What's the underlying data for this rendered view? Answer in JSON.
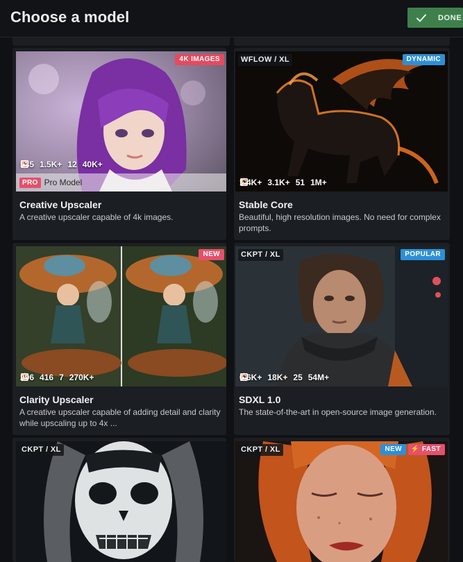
{
  "header": {
    "title": "Choose a model",
    "done_label": "DONE"
  },
  "cards": [
    {
      "name": "Creative Upscaler",
      "description": "A creative upscaler capable of 4k images.",
      "badges": [
        "4K IMAGES"
      ],
      "stats": {
        "stars": "535",
        "likes": "1.5K+",
        "comments": "12",
        "images": "40K+"
      },
      "pro_badge": "PRO",
      "pro_label": "Pro Model"
    },
    {
      "name": "Stable Core",
      "description": "Beautiful, high resolution images. No need for complex prompts.",
      "base": "WFLOW / XL",
      "badges": [
        "DYNAMIC"
      ],
      "stats": {
        "stars": "1.4K+",
        "likes": "3.1K+",
        "comments": "51",
        "images": "1M+"
      }
    },
    {
      "name": "Clarity Upscaler",
      "description": "A creative upscaler capable of adding detail and clarity while upscaling up to 4x ...",
      "badges": [
        "NEW"
      ],
      "stats": {
        "stars": "296",
        "likes": "416",
        "comments": "7",
        "images": "270K+"
      }
    },
    {
      "name": "SDXL 1.0",
      "description": "The state-of-the-art in open-source image generation.",
      "base": "CKPT / XL",
      "badges": [
        "POPULAR"
      ],
      "stats": {
        "stars": "6.6K+",
        "likes": "18K+",
        "comments": "25",
        "images": "54M+"
      }
    },
    {
      "base": "CKPT / XL"
    },
    {
      "base": "CKPT / XL",
      "badges": [
        "NEW",
        "FAST"
      ]
    }
  ],
  "icons": {
    "star": "star-icon",
    "heart": "heart-icon",
    "comment": "comment-icon",
    "images": "image-icon",
    "check": "check-icon",
    "bolt": "bolt-icon"
  },
  "colors": {
    "done_button": "#3f7f4c",
    "badge_red": "#e54a5e",
    "badge_blue": "#2d8fd6",
    "heart": "#e5506a",
    "card_bg": "#1b1e22",
    "page_bg": "#0f1114"
  }
}
